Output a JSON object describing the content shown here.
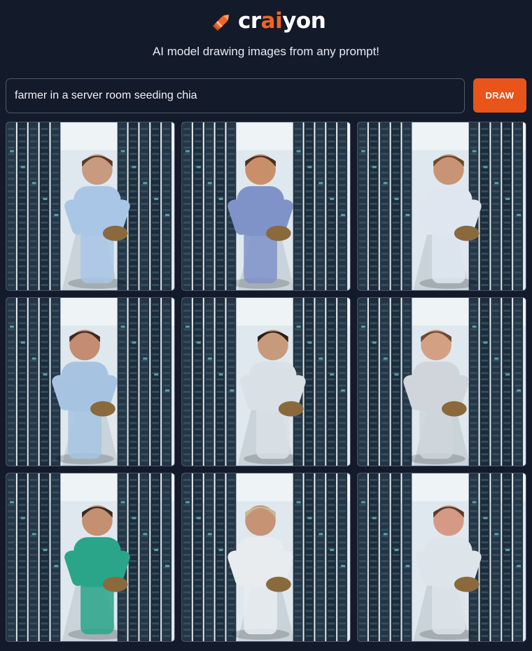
{
  "header": {
    "logo": {
      "text_before": "cr",
      "text_accent": "ai",
      "text_after": "yon",
      "icon": "crayon-icon",
      "accent_color": "#f26522"
    },
    "tagline": "AI model drawing images from any prompt!"
  },
  "search": {
    "value": "farmer in a server room seeding chia",
    "placeholder": ""
  },
  "draw_button": {
    "label": "DRAW",
    "color": "#e8541a"
  },
  "gallery": {
    "image_count": 9,
    "images": [
      {
        "subject": "farmer-1",
        "shirt": "#a9c6e6",
        "skin": "#c89a80",
        "hair": "#5a3a22"
      },
      {
        "subject": "farmer-2",
        "shirt": "#8093c9",
        "skin": "#c98f6a",
        "hair": "#4a3020"
      },
      {
        "subject": "farmer-3",
        "shirt": "#dfe6f0",
        "skin": "#c99476",
        "hair": "#6a4a2a"
      },
      {
        "subject": "farmer-4",
        "shirt": "#a6c4e2",
        "skin": "#c48c70",
        "hair": "#3a2a22"
      },
      {
        "subject": "farmer-5",
        "shirt": "#d9e0e6",
        "skin": "#c89a7c",
        "hair": "#2a1e18"
      },
      {
        "subject": "farmer-6",
        "shirt": "#cfd5db",
        "skin": "#d4a084",
        "hair": "#6a4a30"
      },
      {
        "subject": "farmer-7",
        "shirt": "#2aa58a",
        "skin": "#c49070",
        "hair": "#3a2a22"
      },
      {
        "subject": "farmer-8",
        "shirt": "#e8ecef",
        "skin": "#c69474",
        "hair": "#c8b896"
      },
      {
        "subject": "farmer-9",
        "shirt": "#dde4ea",
        "skin": "#d49a86",
        "hair": "#5a3a28"
      }
    ]
  }
}
